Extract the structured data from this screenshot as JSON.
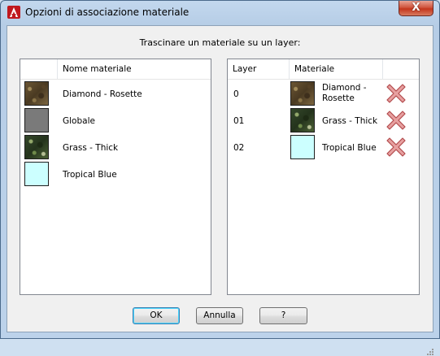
{
  "window": {
    "title": "Opzioni di associazione materiale",
    "close_label": "X"
  },
  "instruction": "Trascinare un materiale su un layer:",
  "materials_panel": {
    "header": "Nome materiale",
    "items": [
      {
        "name": "Diamond - Rosette",
        "swatch": "diamond-texture"
      },
      {
        "name": "Globale",
        "swatch": "#7a7a7a"
      },
      {
        "name": "Grass - Thick",
        "swatch": "grass-texture"
      },
      {
        "name": "Tropical Blue",
        "swatch": "#ccffff"
      }
    ]
  },
  "layers_panel": {
    "headers": {
      "layer": "Layer",
      "material": "Materiale"
    },
    "rows": [
      {
        "layer": "0",
        "material": "Diamond - Rosette",
        "swatch": "diamond-texture",
        "action": "delete-x-icon"
      },
      {
        "layer": "01",
        "material": "Grass - Thick",
        "swatch": "grass-texture",
        "action": "delete-x-icon"
      },
      {
        "layer": "02",
        "material": "Tropical Blue",
        "swatch": "#ccffff",
        "action": "delete-x-icon"
      }
    ]
  },
  "buttons": {
    "ok": "OK",
    "cancel": "Annulla",
    "help": "?"
  },
  "colors": {
    "title_bar": "#b9d1ea",
    "close_button": "#c4361c",
    "delete_icon": "#d9787a",
    "default_button_border": "#3c7fb1"
  }
}
